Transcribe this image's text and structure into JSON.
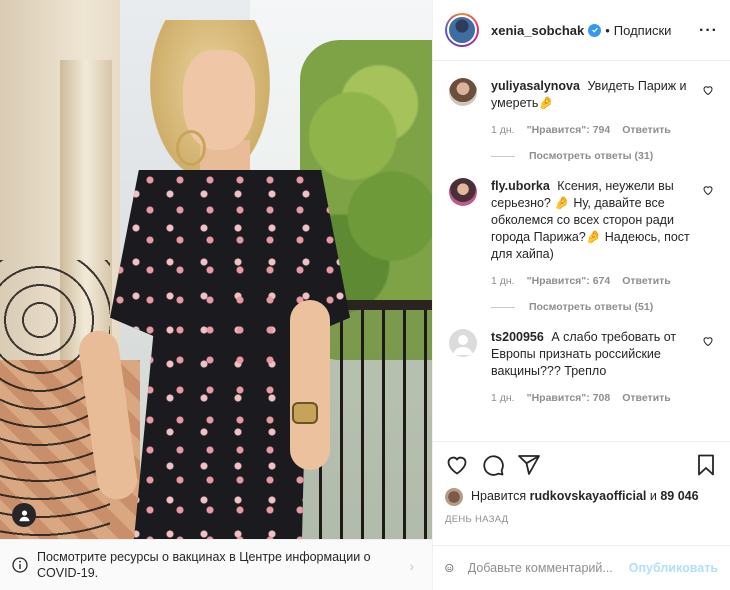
{
  "post": {
    "username": "xenia_sobchak",
    "separator": "•",
    "follow_label": "Подписки",
    "more_label": "···"
  },
  "comments": [
    {
      "user": "yuliyasalynova",
      "text": "Увидеть Париж и умереть🤌",
      "time": "1 дн.",
      "likes": "\"Нравится\": 794",
      "reply": "Ответить",
      "view_replies": "Посмотреть ответы (31)"
    },
    {
      "user": "fly.uborka",
      "text": "Ксения, неужели вы серьезно? 🤌 Ну, давайте все обколемся со всех сторон ради города Парижа?🤌 Надеюсь, пост для хайпа)",
      "time": "1 дн.",
      "likes": "\"Нравится\": 674",
      "reply": "Ответить",
      "view_replies": "Посмотреть ответы (51)"
    },
    {
      "user": "ts200956",
      "text": "А слабо требовать от Европы признать российские вакцины??? Трепло",
      "time": "1 дн.",
      "likes": "\"Нравится\": 708",
      "reply": "Ответить"
    }
  ],
  "likes": {
    "prefix": "Нравится",
    "user": "rudkovskayaofficial",
    "suffix": "и",
    "others": "89 046"
  },
  "timestamp": "День назад",
  "add_comment": {
    "placeholder": "Добавьте комментарий...",
    "post_label": "Опубликовать"
  },
  "covid_banner": {
    "text": "Посмотрите ресурсы о вакцинах в Центре информации о COVID-19.",
    "chevron": "›"
  },
  "colors": {
    "verified": "#3897f0",
    "post_button_disabled": "#b2dffc",
    "meta_text": "#8e8e8e"
  }
}
